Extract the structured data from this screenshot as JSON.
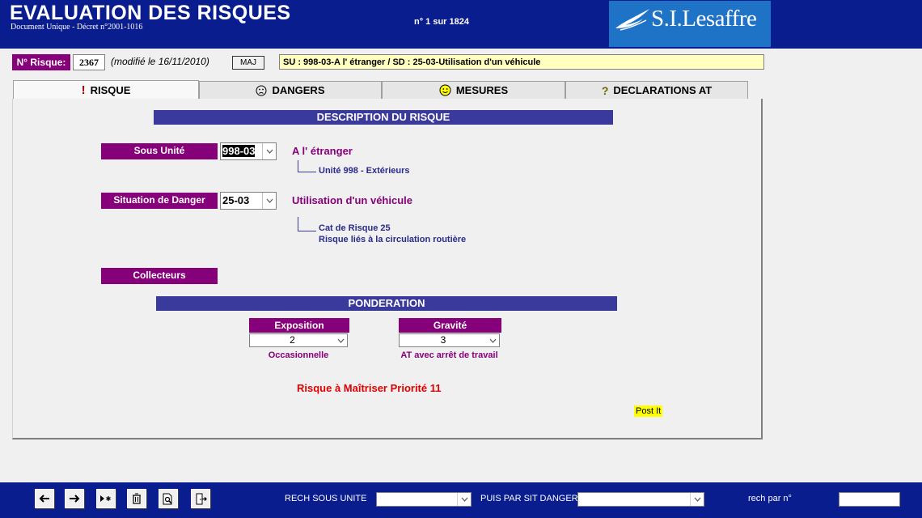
{
  "header": {
    "title": "EVALUATION DES RISQUES",
    "subtitle": "Document Unique -  Décret n°2001-1016",
    "record_counter": "n° 1 sur 1824",
    "logo_text": "S.I.Lesaffre"
  },
  "risk": {
    "label": "N° Risque:",
    "number": "2367",
    "modified": "(modifié le 16/11/2010)",
    "maj_button": "MAJ",
    "summary": "SU : 998-03-A l' étranger / SD : 25-03-Utilisation d'un véhicule"
  },
  "tabs": [
    {
      "label": "RISQUE",
      "icon": "exclamation-icon"
    },
    {
      "label": "DANGERS",
      "icon": "sad-face-icon"
    },
    {
      "label": "MESURES",
      "icon": "smiley-icon"
    },
    {
      "label": "DECLARATIONS AT",
      "icon": "question-icon"
    }
  ],
  "description": {
    "title": "DESCRIPTION DU RISQUE",
    "sous_unite_label": "Sous Unité",
    "sous_unite_value": "998-03",
    "sous_unite_desc": "A l' étranger",
    "unite_text": "Unité 998 - Extérieurs",
    "situation_label": "Situation de Danger",
    "situation_value": "25-03",
    "situation_desc": "Utilisation d'un véhicule",
    "cat_text": "Cat de Risque 25",
    "risque_lie_text": "Risque liés à la circulation routière",
    "collecteurs_label": "Collecteurs"
  },
  "ponderation": {
    "title": "PONDERATION",
    "exposition_label": "Exposition",
    "exposition_value": "2",
    "exposition_desc": "Occasionnelle",
    "gravite_label": "Gravité",
    "gravite_value": "3",
    "gravite_desc": "AT avec arrêt de travail",
    "priority": "Risque à Maîtriser Priorité 11",
    "post_it": "Post It"
  },
  "footer": {
    "rech_sous_label": "RECH SOUS UNITE",
    "puis_label": "PUIS PAR SIT DANGER",
    "rech_no_label": "rech par n°"
  },
  "colors": {
    "header_bg": "#0a1d8f",
    "purple": "#86007a",
    "section_bar": "#3a3a9c",
    "summary_bg": "#ffffc0",
    "priority_red": "#e00000"
  }
}
